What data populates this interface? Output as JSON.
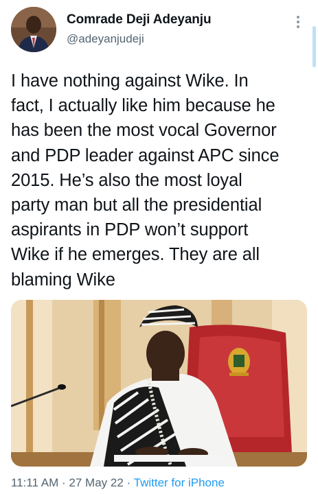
{
  "tweet": {
    "author": {
      "display_name": "Comrade Deji Adeyanju",
      "handle": "@adeyanjudeji"
    },
    "text_lines": [
      "I have nothing against Wike. In",
      "fact, I actually like him because he",
      "has been the most vocal Governor",
      "and PDP leader against APC since",
      "2015. He’s also the most loyal",
      "party man but all the presidential",
      "aspirants in PDP won’t support",
      "Wike if he emerges. They are all",
      "blaming Wike"
    ],
    "time": "11:11 AM",
    "separator1": " · ",
    "date": "27 May 22",
    "separator2": " · ",
    "source": "Twitter for iPhone"
  },
  "colors": {
    "text_primary": "#0f1419",
    "text_secondary": "#536471",
    "link_blue": "#1d9bf0"
  },
  "icons": {
    "more": "more-vertical-icon"
  }
}
